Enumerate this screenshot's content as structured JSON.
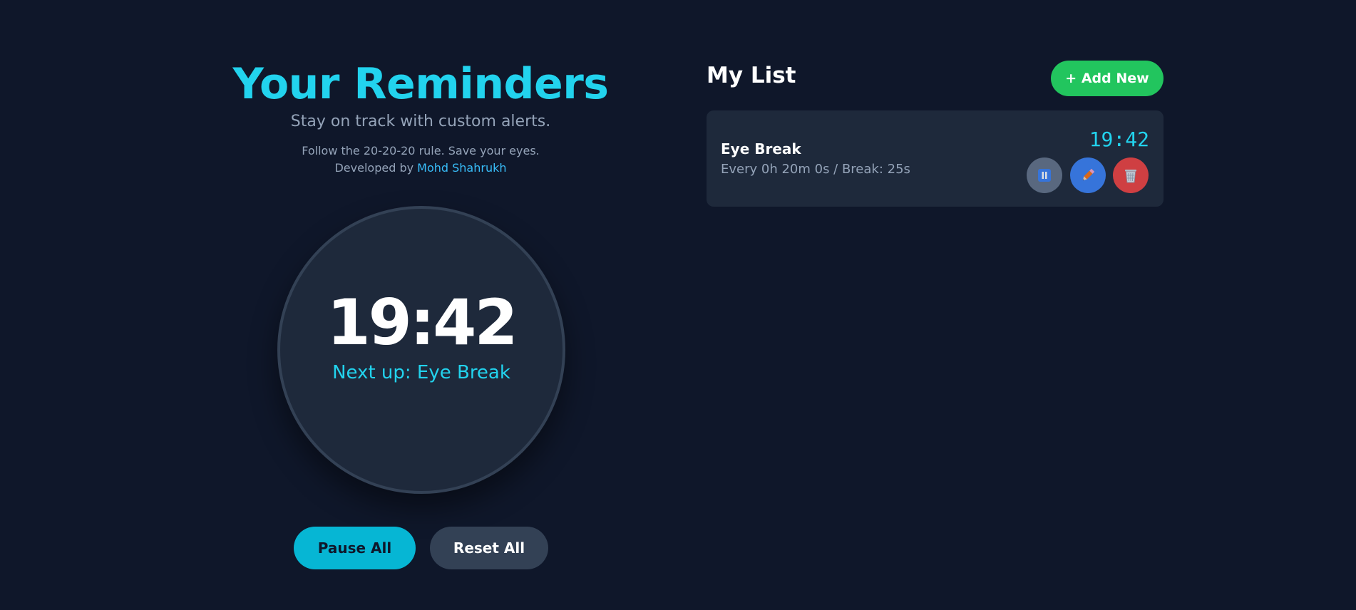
{
  "left": {
    "title": "Your Reminders",
    "subtitle": "Stay on track with custom alerts.",
    "tip": "Follow the 20-20-20 rule. Save your eyes.",
    "credit_prefix": "Developed by ",
    "credit_name": "Mohd Shahrukh"
  },
  "clock": {
    "time": "19:42",
    "next_label": "Next up: Eye Break"
  },
  "controls": {
    "pause_label": "Pause All",
    "reset_label": "Reset All"
  },
  "list": {
    "title": "My List",
    "add_label": "+ Add New",
    "items": [
      {
        "name": "Eye Break",
        "meta": "Every 0h 20m 0s / Break: 25s",
        "time": "19:42",
        "actions": [
          "pause-icon",
          "pencil-icon",
          "trash-icon"
        ]
      }
    ]
  },
  "colors": {
    "background": "#0f172a",
    "accent": "#22d3ee",
    "add": "#22c55e",
    "edit": "#3b82f6",
    "delete": "#ef4444"
  }
}
